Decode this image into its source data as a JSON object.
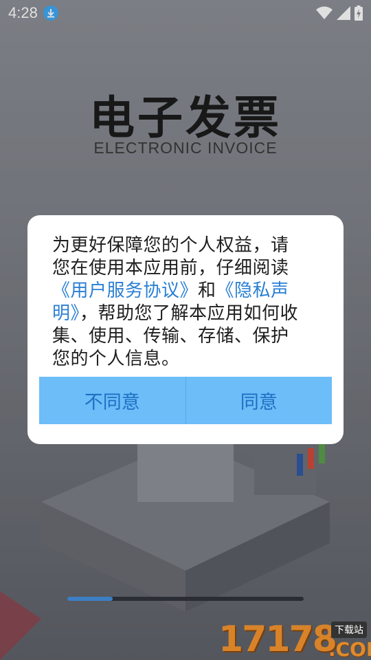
{
  "status_bar": {
    "time": "4:28",
    "icons": [
      "download-icon",
      "wifi-icon",
      "signal-icon",
      "battery-icon"
    ]
  },
  "background_app": {
    "title": "电子发票",
    "subtitle": "ELECTRONIC INVOICE"
  },
  "dialog": {
    "text_before": "为更好保障您的个人权益，请您在使用本应用前，仔细阅读",
    "link_terms": "《用户服务协议》",
    "text_and": "和",
    "link_privacy": "《隐私声明》",
    "text_after": "，帮助您了解本应用如何收集、使用、传输、存储、保护您的个人信息。",
    "disagree_label": "不同意",
    "agree_label": "同意"
  },
  "watermark": {
    "number": "17178",
    "tag": "下载站",
    "domain": ".COM"
  },
  "colors": {
    "link": "#2a7fd4",
    "button_bg": "#6cbdf8",
    "button_text": "#1f6fc4"
  }
}
